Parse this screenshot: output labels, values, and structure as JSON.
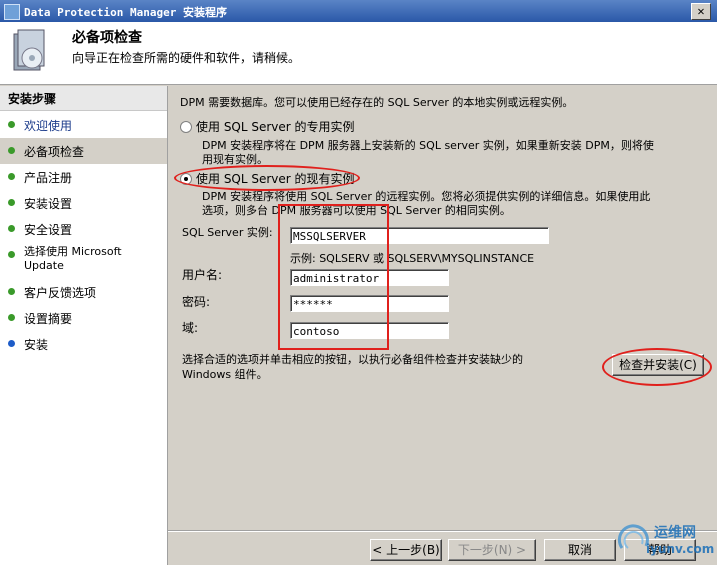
{
  "window": {
    "title": "Data Protection Manager 安装程序",
    "close_label": "✕"
  },
  "header": {
    "title": "必备项检查",
    "subtitle": "向导正在检查所需的硬件和软件，请稍候。"
  },
  "sidebar": {
    "heading": "安装步骤",
    "items": [
      {
        "label": "欢迎使用",
        "status": "done"
      },
      {
        "label": "必备项检查",
        "status": "current"
      },
      {
        "label": "产品注册",
        "status": "pending"
      },
      {
        "label": "安装设置",
        "status": "pending"
      },
      {
        "label": "安全设置",
        "status": "pending"
      },
      {
        "label": "选择使用 Microsoft\nUpdate",
        "status": "pending"
      },
      {
        "label": "客户反馈选项",
        "status": "pending"
      },
      {
        "label": "设置摘要",
        "status": "pending"
      },
      {
        "label": "安装",
        "status": "pending"
      }
    ]
  },
  "main": {
    "intro": "DPM 需要数据库。您可以使用已经存在的 SQL Server 的本地实例或远程实例。",
    "option_dedicated": {
      "label": "使用 SQL Server 的专用实例",
      "desc_line1": "DPM 安装程序将在 DPM 服务器上安装新的 SQL server 实例，如果重新安装 DPM，则将使",
      "desc_line2": "用现有实例。",
      "selected": false
    },
    "option_existing": {
      "label": "使用 SQL Server 的现有实例",
      "desc_line1": "DPM 安装程序将使用 SQL Server 的远程实例。您将必须提供实例的详细信息。如果使用此",
      "desc_line2": "选项，则多台 DPM 服务器可以使用 SQL Server 的相同实例。",
      "selected": true
    },
    "instance_label": "SQL Server 实例:",
    "instance_value": "MSSQLSERVER",
    "example_text": "示例: SQLSERV 或 SQLSERV\\MYSQLINSTANCE",
    "username_label": "用户名:",
    "username_value": "administrator",
    "password_label": "密码:",
    "password_value": "******",
    "domain_label": "域:",
    "domain_value": "contoso",
    "hint_line1": "选择合适的选项并单击相应的按钮，以执行必备组件检查并安装缺少的",
    "hint_line2": "Windows 组件。",
    "check_install_button": "检查并安装(C)"
  },
  "footer": {
    "back_button": "< 上一步(B)",
    "next_button": "下一步(N) >",
    "cancel_button": "取消",
    "help_button": "帮助"
  },
  "watermark": {
    "text": "运维网",
    "url_text": "iyunv.com"
  },
  "colors": {
    "annotation_red": "#e0201c",
    "title_blue": "#2a58a8",
    "dialog_grey": "#d4d0c8"
  }
}
